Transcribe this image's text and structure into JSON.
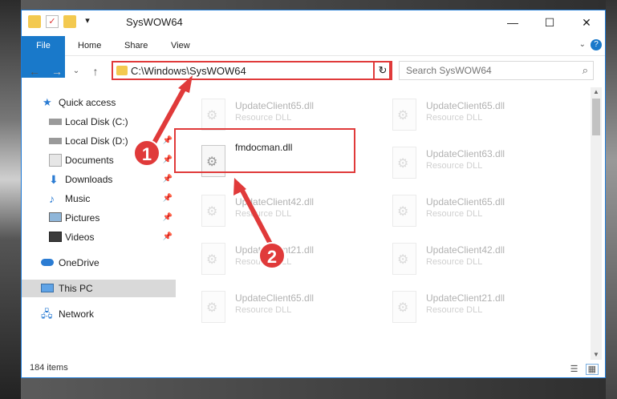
{
  "window": {
    "title": "SysWOW64"
  },
  "ribbon": {
    "tabs": [
      "File",
      "Home",
      "Share",
      "View"
    ]
  },
  "address": {
    "path": "C:\\Windows\\SysWOW64"
  },
  "search": {
    "placeholder": "Search SysWOW64"
  },
  "nav": {
    "items": [
      {
        "label": "Quick access",
        "icon": "star-icon"
      },
      {
        "label": "Local Disk (C:)",
        "icon": "drive-icon"
      },
      {
        "label": "Local Disk (D:)",
        "icon": "drive-icon"
      },
      {
        "label": "Documents",
        "icon": "documents-icon"
      },
      {
        "label": "Downloads",
        "icon": "download-icon"
      },
      {
        "label": "Music",
        "icon": "music-icon"
      },
      {
        "label": "Pictures",
        "icon": "pictures-icon"
      },
      {
        "label": "Videos",
        "icon": "videos-icon"
      },
      {
        "label": "OneDrive",
        "icon": "cloud-icon"
      },
      {
        "label": "This PC",
        "icon": "computer-icon"
      },
      {
        "label": "Network",
        "icon": "network-icon"
      }
    ]
  },
  "files": {
    "main": {
      "name": "fmdocman.dll"
    },
    "faded": [
      {
        "name": "UpdateClient65.dll",
        "type": "Resource DLL"
      },
      {
        "name": "UpdateClient65.dll",
        "type": "Resource DLL"
      },
      {
        "name": "UpdateClient63.dll",
        "type": "Resource DLL"
      },
      {
        "name": "UpdateClient42.dll",
        "type": "Resource DLL"
      },
      {
        "name": "UpdateClient65.dll",
        "type": "Resource DLL"
      },
      {
        "name": "UpdateClient21.dll",
        "type": "Resource DLL"
      },
      {
        "name": "UpdateClient42.dll",
        "type": "Resource DLL"
      },
      {
        "name": "UpdateClient65.dll",
        "type": "Resource DLL"
      },
      {
        "name": "UpdateClient21.dll",
        "type": "Resource DLL"
      }
    ]
  },
  "status": {
    "items": "184 items"
  },
  "callouts": [
    "1",
    "2"
  ],
  "colors": {
    "accent": "#1979ca",
    "highlight": "#e03a3a"
  }
}
